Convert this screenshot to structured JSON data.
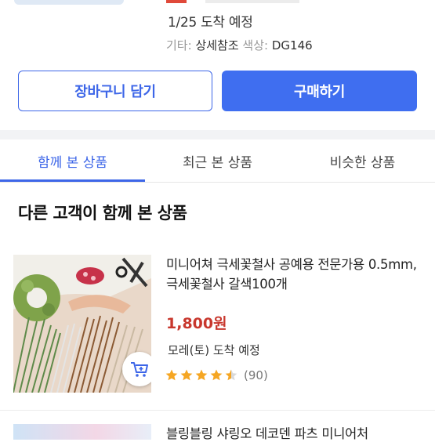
{
  "order": {
    "arrival": "1/25 도착 예정",
    "options_label": "기타: ",
    "options_value": "상세참조",
    "color_label": "색상: ",
    "color_value": "DG146"
  },
  "actions": {
    "cart_label": "장바구니 담기",
    "buy_label": "구매하기"
  },
  "tabs": [
    {
      "label": "함께 본 상품",
      "active": true
    },
    {
      "label": "최근 본 상품",
      "active": false
    },
    {
      "label": "비슷한 상품",
      "active": false
    }
  ],
  "section": {
    "title": "다른 고객이 함께 본 상품"
  },
  "products": [
    {
      "name": "미니어쳐 극세꽃철사 공예용 전문가용 0.5mm, 극세꽃철사 갈색100개",
      "price": "1,800원",
      "delivery": "모레(토) 도착 예정",
      "rating": 4.5,
      "reviews": "(90)"
    },
    {
      "name": "블링블링 샤링오 데코덴 파츠 미니어처"
    }
  ],
  "colors": {
    "accent": "#3d66e8",
    "buy_button": "#3f6ef0",
    "price": "#c8372d",
    "star": "#f5a623"
  },
  "icons": {
    "add_to_cart": "cart-plus-icon",
    "star": "star-icon"
  }
}
